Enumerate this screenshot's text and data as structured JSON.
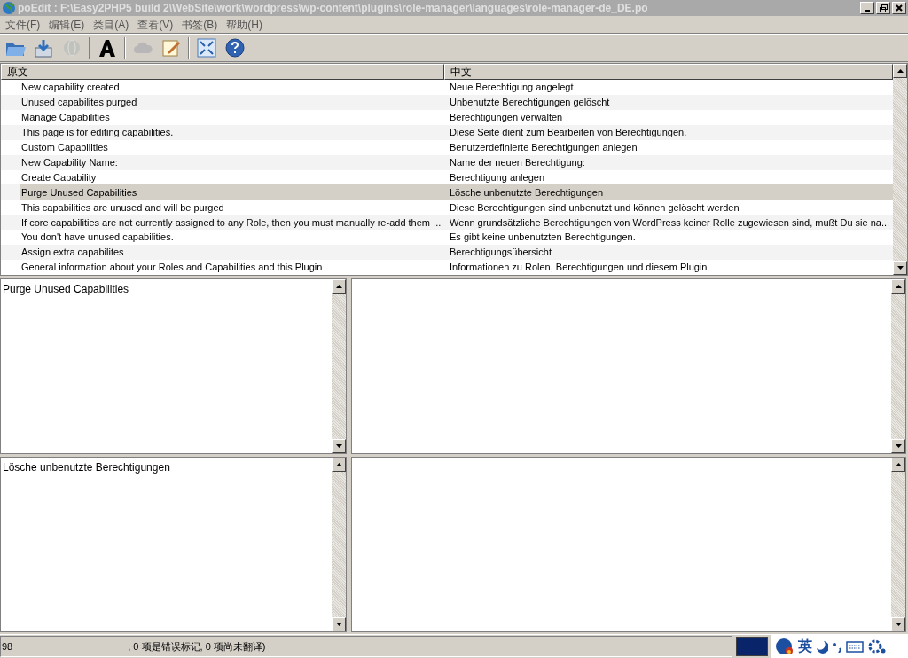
{
  "window": {
    "title": "poEdit : F:\\Easy2PHP5 build 2\\WebSite\\work\\wordpress\\wp-content\\plugins\\role-manager\\languages\\role-manager-de_DE.po",
    "active": false
  },
  "menu": [
    "文件(F)",
    "编辑(E)",
    "类目(A)",
    "查看(V)",
    "书签(B)",
    "帮助(H)"
  ],
  "toolbar": [
    {
      "kind": "open",
      "disabled": false
    },
    {
      "kind": "save",
      "disabled": false
    },
    {
      "kind": "globe",
      "disabled": true
    },
    {
      "kind": "sep"
    },
    {
      "kind": "font",
      "disabled": false
    },
    {
      "kind": "sep"
    },
    {
      "kind": "cloud",
      "disabled": true
    },
    {
      "kind": "notepad",
      "disabled": false
    },
    {
      "kind": "sep"
    },
    {
      "kind": "fullscreen",
      "disabled": false
    },
    {
      "kind": "help",
      "disabled": false
    }
  ],
  "table": {
    "columns": [
      "原文",
      "中文"
    ],
    "rows": [
      {
        "source": "New capability created",
        "translation": "Neue Berechtigung angelegt",
        "selected": false
      },
      {
        "source": "Unused capabilites purged",
        "translation": "Unbenutzte Berechtigungen gelöscht",
        "selected": false
      },
      {
        "source": "Manage Capabilities",
        "translation": "Berechtigungen verwalten",
        "selected": false
      },
      {
        "source": "This page is for editing capabilities.",
        "translation": "Diese Seite dient zum Bearbeiten von Berechtigungen.",
        "selected": false
      },
      {
        "source": "Custom Capabilities",
        "translation": "Benutzerdefinierte Berechtigungen anlegen",
        "selected": false
      },
      {
        "source": "New Capability Name:",
        "translation": "Name der neuen Berechtigung:",
        "selected": false
      },
      {
        "source": "Create Capability",
        "translation": "Berechtigung anlegen",
        "selected": false
      },
      {
        "source": "Purge Unused Capabilities",
        "translation": "Lösche unbenutzte Berechtigungen",
        "selected": true
      },
      {
        "source": "This capabilities are unused and will be purged",
        "translation": "Diese Berechtigungen sind unbenutzt und können gelöscht werden",
        "selected": false
      },
      {
        "source": "If core capabilities are not currently assigned to any Role, then you must manually re-add them ...",
        "translation": "Wenn grundsätzliche Berechtigungen von WordPress keiner Rolle zugewiesen sind, mußt Du sie na...",
        "selected": false
      },
      {
        "source": "You don't have unused capabilities.",
        "translation": "Es gibt keine unbenutzten Berechtigungen.",
        "selected": false
      },
      {
        "source": "Assign extra capabilites",
        "translation": "Berechtigungsübersicht",
        "selected": false
      },
      {
        "source": "General information about your Roles and Capabilities and this Plugin",
        "translation": "Informationen zu Rolen, Berechtigungen und diesem Plugin",
        "selected": false
      }
    ]
  },
  "source_pane": {
    "text": "Purge Unused Capabilities"
  },
  "translation_pane": {
    "text": "Lösche unbenutzte Berechtigungen"
  },
  "status_bar": {
    "text_start": "98",
    "text_end": ", 0 项是错误标记, 0 项尚未翻译)"
  },
  "tray": [
    {
      "kind": "ime"
    },
    {
      "kind": "lang",
      "text": "英"
    },
    {
      "kind": "moon"
    },
    {
      "kind": "punct"
    },
    {
      "kind": "keyboard"
    },
    {
      "kind": "gear"
    }
  ]
}
